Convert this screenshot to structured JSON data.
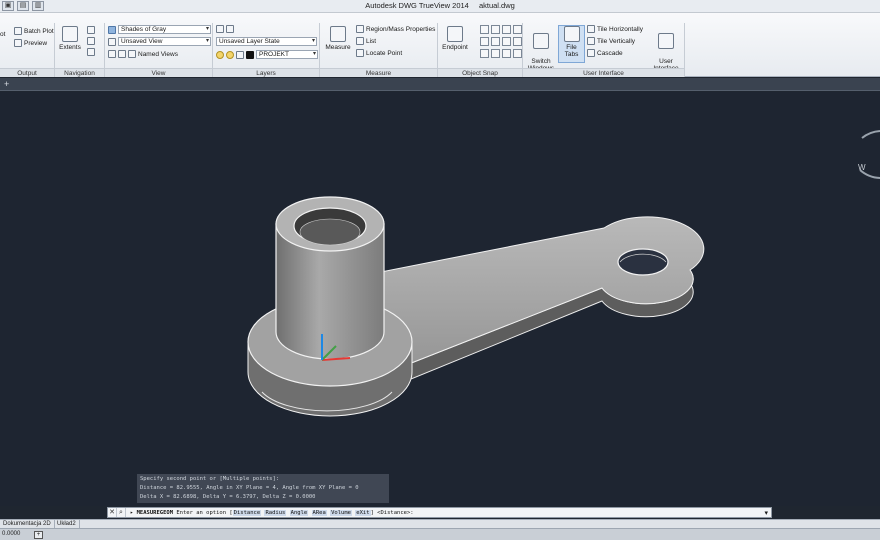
{
  "window": {
    "app_title": "Autodesk DWG TrueView 2014",
    "file_name": "aktual.dwg"
  },
  "ribbon": {
    "output": {
      "title": "Output",
      "plot_label": "ot",
      "batch_plot": "Batch Plot",
      "preview": "Preview"
    },
    "navigation": {
      "title": "Navigation",
      "extents": "Extents"
    },
    "view": {
      "title": "View",
      "visual_style": "Shades of Gray",
      "saved_view": "Unsaved View",
      "named_views": "Named Views"
    },
    "layers": {
      "title": "Layers",
      "layer_state": "Unsaved Layer State",
      "current_layer": "PROJEKT"
    },
    "measure": {
      "title": "Measure",
      "measure": "Measure",
      "region_mass": "Region/Mass Properties",
      "list": "List",
      "locate_point": "Locate Point"
    },
    "object_snap": {
      "title": "Object Snap",
      "endpoint": "Endpoint"
    },
    "user_interface": {
      "title": "User Interface",
      "switch_windows": "Switch\nWindows",
      "file_tabs": "File Tabs",
      "tile_horizontally": "Tile Horizontally",
      "tile_vertically": "Tile Vertically",
      "cascade": "Cascade",
      "user_interface": "User\nInterface"
    }
  },
  "command_history": [
    "Specify second point or [Multiple points]:",
    "Distance = 82.9555,  Angle in XY Plane = 4,  Angle from XY Plane = 0",
    "Delta X = 82.6898,  Delta Y = 6.3797,  Delta Z = 0.0000"
  ],
  "command_line": {
    "command": "MEASUREGEOM",
    "prompt": "Enter an option",
    "options": [
      "Distance",
      "Radius",
      "Angle",
      "ARea",
      "Volume",
      "eXit"
    ],
    "default": "<Distance>:"
  },
  "layout_tabs": [
    "Dokumentacja 2D",
    "Układ2"
  ],
  "status": {
    "coordinates": "0.0000"
  },
  "colors": {
    "viewport_bg": "#1e2531",
    "part_fill": "#8a8a8a",
    "part_edge": "#f2f2f2"
  }
}
